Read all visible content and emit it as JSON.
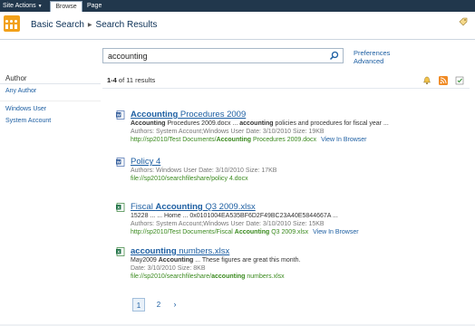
{
  "ribbon": {
    "site_actions_label": "Site Actions",
    "tabs": [
      {
        "label": "Browse",
        "selected": true
      },
      {
        "label": "Page",
        "selected": false
      }
    ]
  },
  "header": {
    "breadcrumb": [
      "Basic Search",
      "Search Results"
    ],
    "logo_icon": "sharepoint-site-logo-icon",
    "tag_icon": "tags-notes-icon"
  },
  "search": {
    "query": "accounting",
    "go_icon": "search-icon",
    "preferences_label": "Preferences",
    "advanced_label": "Advanced"
  },
  "refinement": {
    "heading": "Author",
    "items": [
      "Any Author",
      "Windows User",
      "System Account"
    ]
  },
  "results_summary": {
    "range": "1-4",
    "text": " of 11 results"
  },
  "header_icons": [
    "search-alert-icon",
    "rss-icon",
    "settings-icon"
  ],
  "results": [
    {
      "icon": "word-document-icon",
      "title_bold": "Accounting",
      "title_rest": " Procedures 2009",
      "snippet_parts": [
        {
          "t": "Accounting",
          "b": true
        },
        {
          "t": " Procedures 2009.docx ... ",
          "b": false
        },
        {
          "t": "accounting",
          "b": true
        },
        {
          "t": " policies and procedures for fiscal year ...",
          "b": false
        }
      ],
      "meta": "Authors: System Account;Windows User   Date: 3/10/2010   Size: 19KB",
      "url_parts": [
        {
          "t": "http://sp2010/Test Documents/",
          "b": false
        },
        {
          "t": "Accounting",
          "b": true
        },
        {
          "t": " Procedures 2009.docx",
          "b": false
        }
      ],
      "view_in_browser": "View In Browser"
    },
    {
      "icon": "word-document-icon",
      "title_bold": "",
      "title_rest": "Policy 4",
      "snippet_parts": [],
      "meta": "Authors: Windows User   Date: 3/10/2010   Size: 17KB",
      "url_parts": [
        {
          "t": "file://sp2010/searchfileshare/policy 4.docx",
          "b": false
        }
      ],
      "view_in_browser": ""
    },
    {
      "icon": "excel-document-icon",
      "title_pre": "Fiscal ",
      "title_bold": "Accounting",
      "title_rest": " Q3 2009.xlsx",
      "snippet_parts": [
        {
          "t": "15228 ... ... Home ... 0x0101004EA535BF6D2F49BC23A40E5844667A ...",
          "b": false
        }
      ],
      "meta": "Authors: System Account;Windows User   Date: 3/10/2010   Size: 15KB",
      "url_parts": [
        {
          "t": "http://sp2010/Test Documents/Fiscal ",
          "b": false
        },
        {
          "t": "Accounting",
          "b": true
        },
        {
          "t": " Q3 2009.xlsx",
          "b": false
        }
      ],
      "view_in_browser": "View In Browser"
    },
    {
      "icon": "excel-document-icon",
      "title_bold": "accounting",
      "title_rest": " numbers.xlsx",
      "snippet_parts": [
        {
          "t": "May2009 ",
          "b": false
        },
        {
          "t": "Accounting",
          "b": true
        },
        {
          "t": " ... These figures are great this month.",
          "b": false
        }
      ],
      "meta": "Date: 3/10/2010   Size: 8KB",
      "url_parts": [
        {
          "t": "file://sp2010/searchfileshare/",
          "b": false
        },
        {
          "t": "accounting",
          "b": true
        },
        {
          "t": " numbers.xlsx",
          "b": false
        }
      ],
      "view_in_browser": ""
    }
  ],
  "pager": {
    "pages": [
      "1",
      "2"
    ],
    "current": "1",
    "next_label": "›"
  },
  "colors": {
    "ribbon_bg": "#21374c",
    "link": "#1c5ea2",
    "url_green": "#3a8a1e",
    "logo_orange": "#f2a11a"
  }
}
